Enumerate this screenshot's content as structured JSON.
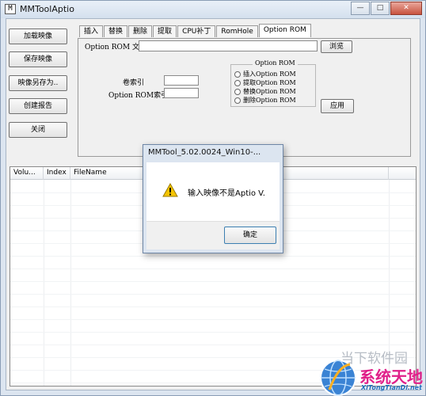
{
  "window": {
    "title": "MMToolAptio",
    "icon_name": "app-icon",
    "icon_glyph": "M",
    "controls": {
      "minimize": "—",
      "maximize": "□",
      "close": "✕"
    }
  },
  "sidebar": {
    "buttons": [
      {
        "label": "加载映像"
      },
      {
        "label": "保存映像"
      },
      {
        "label": "映像另存为.."
      },
      {
        "label": "创建报告"
      },
      {
        "label": "关闭"
      }
    ]
  },
  "tabs": [
    {
      "label": "插入"
    },
    {
      "label": "替换"
    },
    {
      "label": "删除"
    },
    {
      "label": "提取"
    },
    {
      "label": "CPU补丁"
    },
    {
      "label": "RomHole"
    },
    {
      "label": "Option ROM"
    }
  ],
  "panel": {
    "file_label": "Option ROM 文",
    "file_value": "",
    "browse_button": "浏览",
    "volume_index_label": "卷索引",
    "volume_index_value": "",
    "option_rom_index_label": "Option ROM索引",
    "option_rom_index_value": "",
    "group_title": "Option ROM",
    "radios": [
      {
        "label": "插入Option ROM"
      },
      {
        "label": "提取Option ROM"
      },
      {
        "label": "替换Option ROM"
      },
      {
        "label": "删除Option ROM"
      }
    ],
    "apply_button": "应用"
  },
  "list": {
    "columns": [
      "Volu...",
      "Index",
      "FileName"
    ]
  },
  "dialog": {
    "title": "MMTool_5.02.0024_Win10-...",
    "message": "输入映像不是Aptio V.",
    "ok_button": "确定",
    "icon_name": "warning-icon"
  },
  "watermark": {
    "text_top": "当下软件园",
    "brand": "系统天地",
    "url": "XiTongTianDi.net"
  }
}
